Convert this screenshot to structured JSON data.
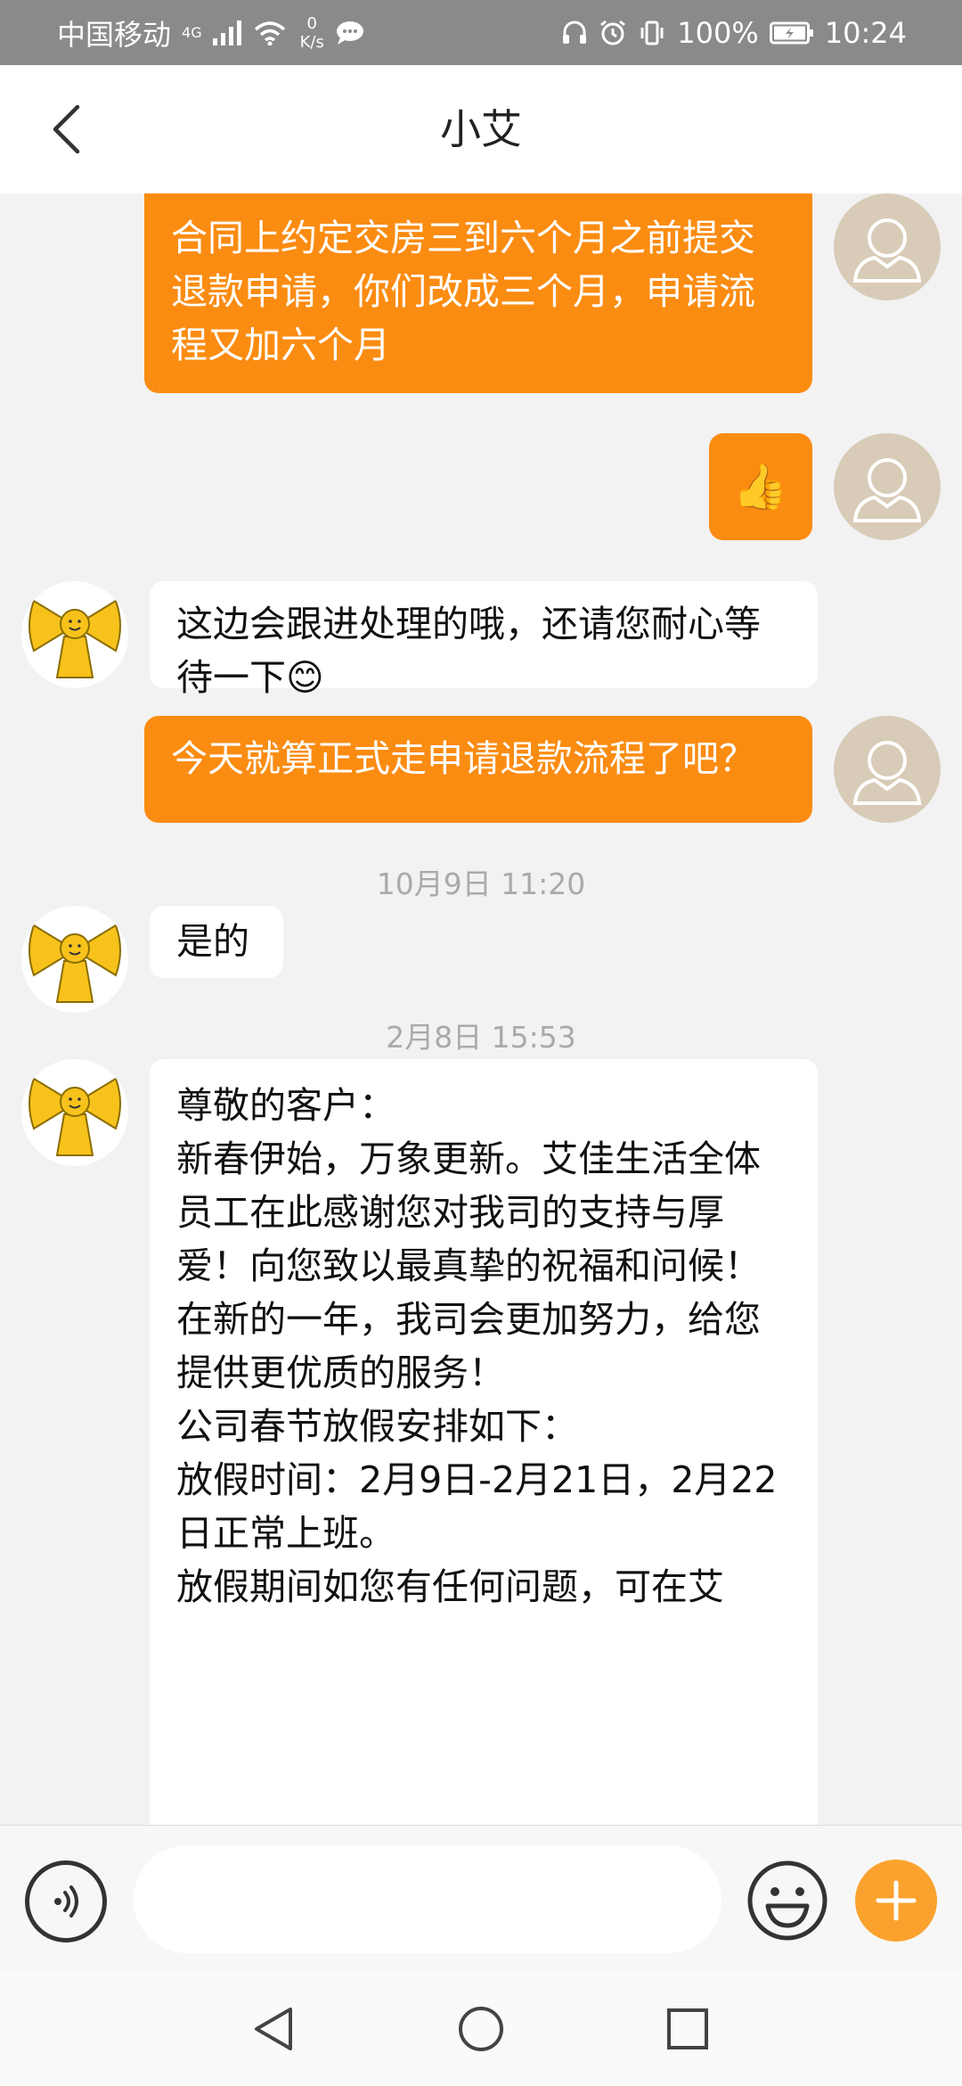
{
  "status_bar": {
    "carrier": "中国移动",
    "network": "4G",
    "speed_value": "0",
    "speed_unit": "K/s",
    "battery": "100%",
    "time": "10:24"
  },
  "header": {
    "title": "小艾"
  },
  "messages": [
    {
      "side": "out",
      "text": "合同上约定交房三到六个月之前提交退款申请，你们改成三个月，申请流程又加六个月"
    },
    {
      "side": "out",
      "type": "emoji",
      "emoji": "👍"
    },
    {
      "side": "in",
      "text": "这边会跟进处理的哦，还请您耐心等待一下",
      "emoji": "😊"
    },
    {
      "side": "out",
      "text": "今天就算正式走申请退款流程了吧？"
    },
    {
      "type": "timestamp",
      "text": "10月9日 11:20"
    },
    {
      "side": "in",
      "text": "是的"
    },
    {
      "type": "timestamp",
      "text": "2月8日 15:53"
    },
    {
      "side": "in",
      "lines": [
        "尊敬的客户：",
        "新春伊始，万象更新。艾佳生活全体员工在此感谢您对我司的支持与厚爱！向您致以最真挚的祝福和问候！在新的一年，我司会更加努力，给您提供更优质的服务！",
        "公司春节放假安排如下：",
        "放假时间：2月9日-2月21日，2月22日正常上班。",
        "放假期间如您有任何问题，可在艾"
      ]
    }
  ],
  "input": {
    "placeholder": ""
  },
  "colors": {
    "accent_orange": "#fb8c12",
    "status_bar_bg": "#8a8a8a",
    "chat_bg": "#f2f2f2"
  },
  "icons": {
    "back": "chevron-left-icon",
    "voice": "voice-icon",
    "emoji": "smiley-icon",
    "plus": "plus-icon",
    "nav_back": "triangle-back-icon",
    "nav_home": "circle-home-icon",
    "nav_recents": "square-recents-icon"
  }
}
